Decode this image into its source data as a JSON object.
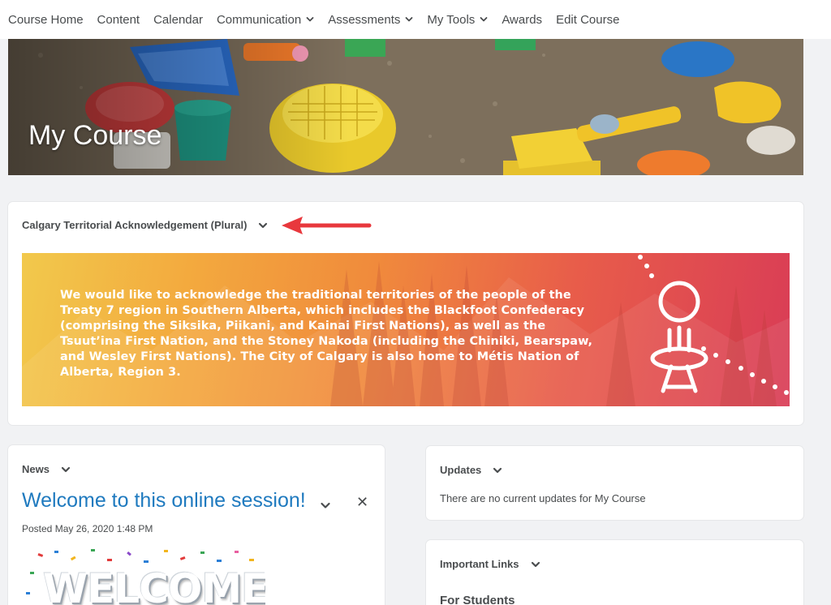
{
  "nav": {
    "items": [
      {
        "label": "Course Home",
        "dropdown": false
      },
      {
        "label": "Content",
        "dropdown": false
      },
      {
        "label": "Calendar",
        "dropdown": false
      },
      {
        "label": "Communication",
        "dropdown": true
      },
      {
        "label": "Assessments",
        "dropdown": true
      },
      {
        "label": "My Tools",
        "dropdown": true
      },
      {
        "label": "Awards",
        "dropdown": false
      },
      {
        "label": "Edit Course",
        "dropdown": false
      }
    ]
  },
  "banner": {
    "title": "My Course"
  },
  "acknowledgement": {
    "heading": "Calgary Territorial Acknowledgement (Plural)",
    "text": "We would like to acknowledge the traditional territories of the people of the Treaty 7 region in Southern Alberta, which includes the Blackfoot Confederacy (comprising the Siksika, Piikani, and Kainai First Nations), as well as the Tsuut’ina First Nation, and the Stoney Nakoda (including the Chiniki, Bearspaw, and Wesley First Nations). The City of Calgary is also home to Métis Nation of Alberta, Region 3."
  },
  "news": {
    "heading": "News",
    "item_title": "Welcome to this online session!",
    "posted": "Posted May 26, 2020 1:48 PM",
    "image_text": "WELCOME!"
  },
  "updates": {
    "heading": "Updates",
    "message": "There are no current updates for My Course"
  },
  "links": {
    "heading": "Important Links",
    "subheading": "For Students"
  },
  "colors": {
    "link_blue": "#1f7abf",
    "annotation_arrow": "#e8383d",
    "text": "#494c4e"
  }
}
